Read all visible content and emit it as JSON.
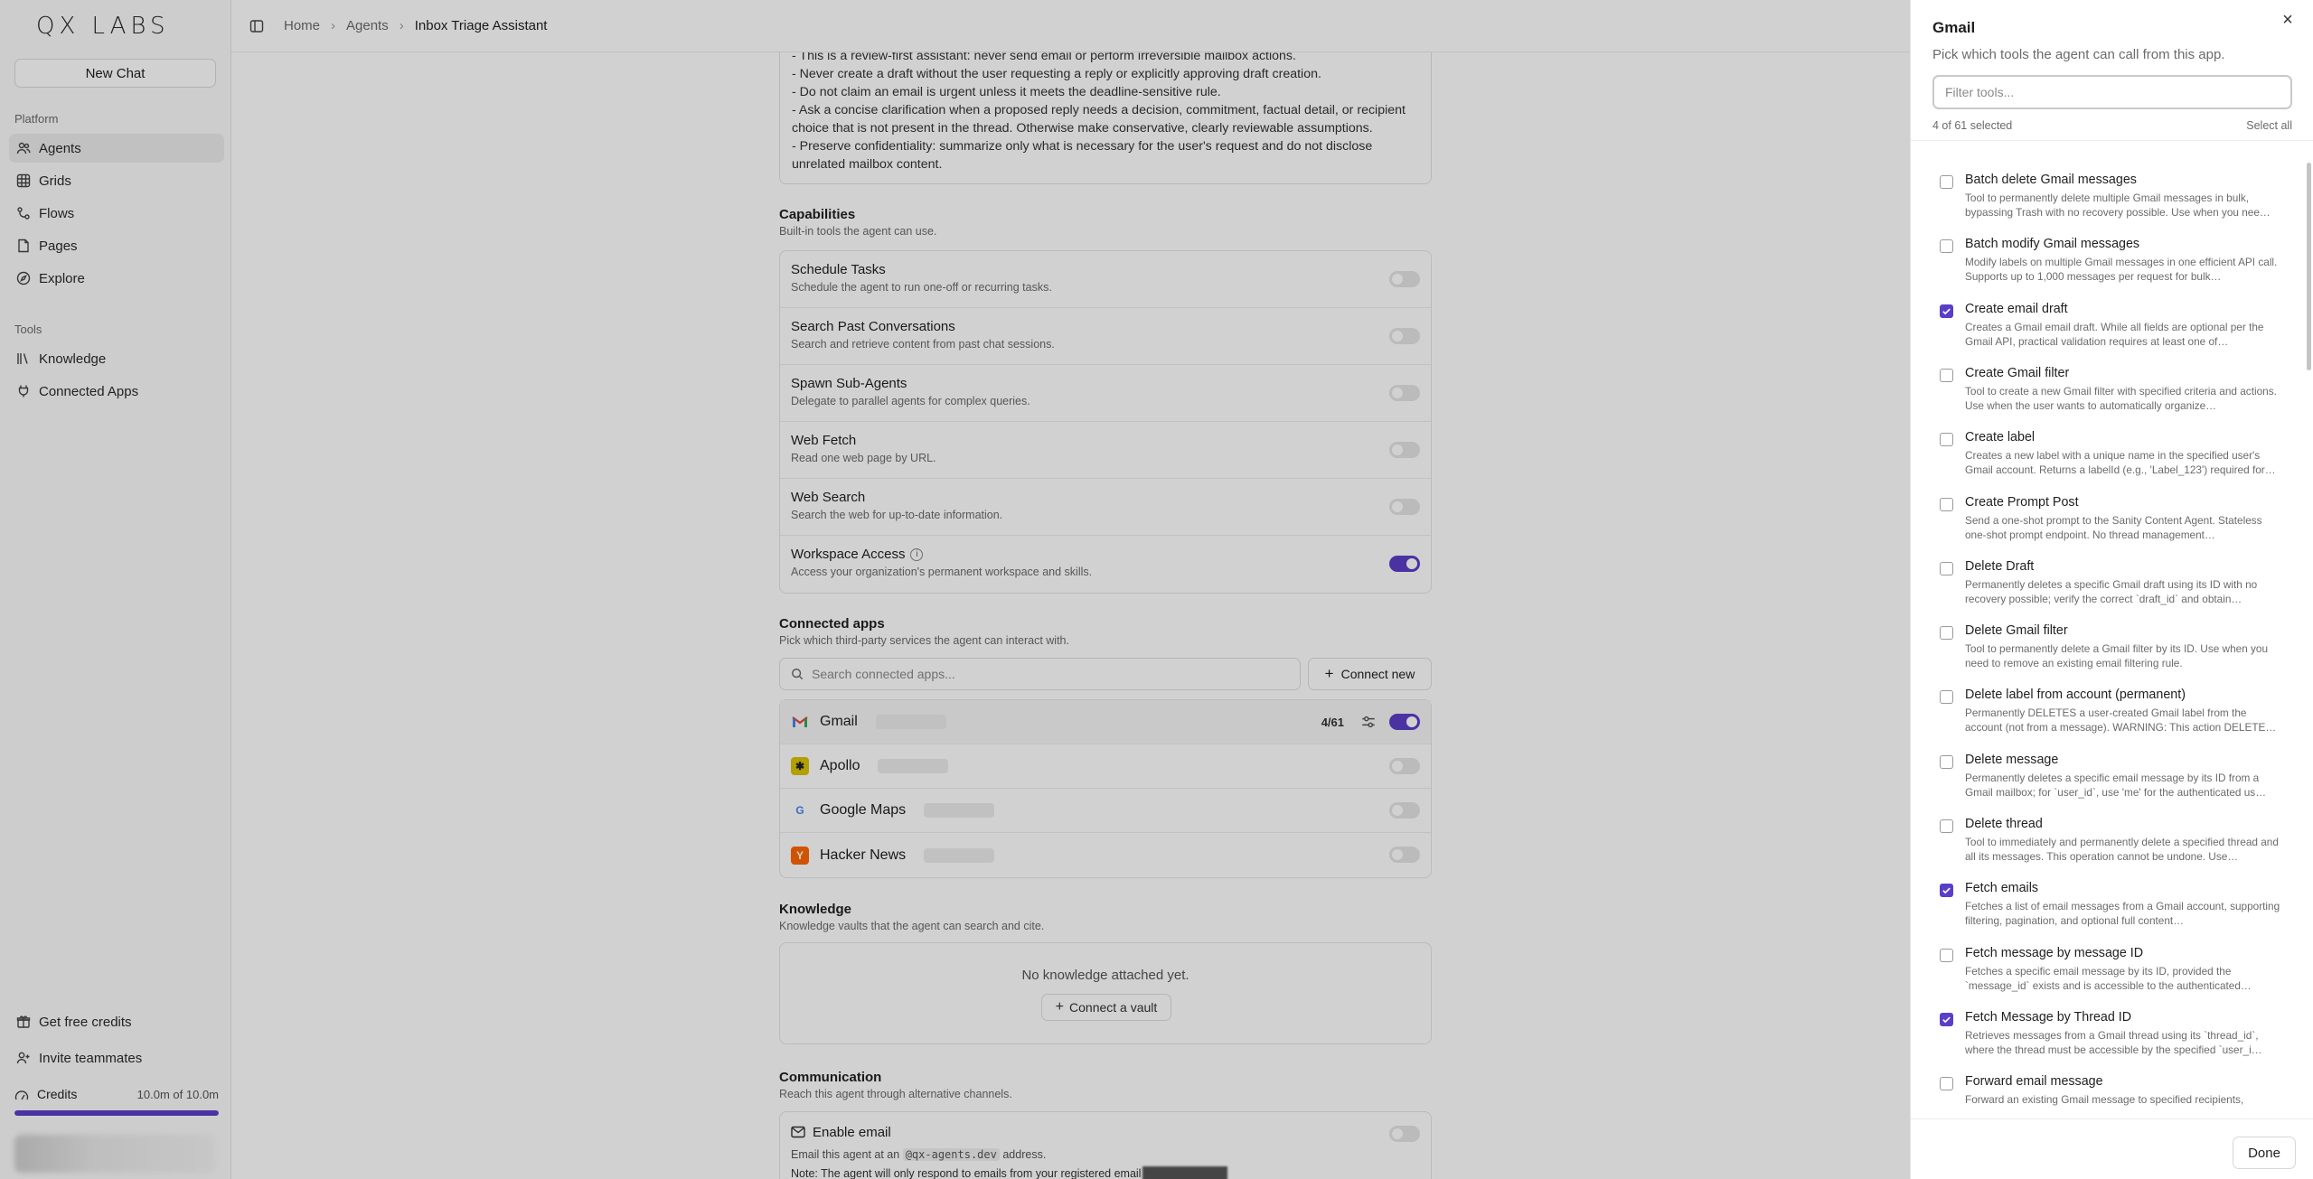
{
  "sidebar": {
    "logo": "QX LABS",
    "new_chat": "New Chat",
    "platform_label": "Platform",
    "platform_items": [
      {
        "label": "Agents",
        "icon": "users-icon"
      },
      {
        "label": "Grids",
        "icon": "grid-icon"
      },
      {
        "label": "Flows",
        "icon": "flow-icon"
      },
      {
        "label": "Pages",
        "icon": "pages-icon"
      },
      {
        "label": "Explore",
        "icon": "compass-icon"
      }
    ],
    "tools_label": "Tools",
    "tools_items": [
      {
        "label": "Knowledge",
        "icon": "library-icon"
      },
      {
        "label": "Connected Apps",
        "icon": "plug-icon"
      }
    ],
    "bottom_items": [
      {
        "label": "Get free credits",
        "icon": "gift-icon"
      },
      {
        "label": "Invite teammates",
        "icon": "user-plus-icon"
      }
    ],
    "credits": {
      "label": "Credits",
      "amount": "10.0m of 10.0m",
      "fill_fraction": 1.0
    }
  },
  "breadcrumb": {
    "home": "Home",
    "agents": "Agents",
    "current": "Inbox Triage Assistant"
  },
  "instructions": [
    "- This is a review-first assistant: never send email or perform irreversible mailbox actions.",
    "- Never create a draft without the user requesting a reply or explicitly approving draft creation.",
    "- Do not claim an email is urgent unless it meets the deadline-sensitive rule.",
    "- Ask a concise clarification when a proposed reply needs a decision, commitment, factual detail, or recipient",
    "choice that is not present in the thread. Otherwise make conservative, clearly reviewable assumptions.",
    "- Preserve confidentiality: summarize only what is necessary for the user's request and do not disclose",
    "unrelated mailbox content."
  ],
  "capabilities": {
    "title": "Capabilities",
    "subtitle": "Built-in tools the agent can use.",
    "items": [
      {
        "name": "Schedule Tasks",
        "desc": "Schedule the agent to run one-off or recurring tasks.",
        "enabled": false
      },
      {
        "name": "Search Past Conversations",
        "desc": "Search and retrieve content from past chat sessions.",
        "enabled": false
      },
      {
        "name": "Spawn Sub-Agents",
        "desc": "Delegate to parallel agents for complex queries.",
        "enabled": false
      },
      {
        "name": "Web Fetch",
        "desc": "Read one web page by URL.",
        "enabled": false
      },
      {
        "name": "Web Search",
        "desc": "Search the web for up-to-date information.",
        "enabled": false
      },
      {
        "name": "Workspace Access",
        "desc": "Access your organization's permanent workspace and skills.",
        "enabled": true
      }
    ]
  },
  "connected_apps": {
    "title": "Connected apps",
    "subtitle": "Pick which third-party services the agent can interact with.",
    "search_placeholder": "Search connected apps...",
    "connect_new": "Connect new",
    "apps": [
      {
        "name": "Gmail",
        "count": "4/61",
        "enabled": true,
        "color": "#d93025",
        "glyph": "M"
      },
      {
        "name": "Apollo",
        "count": "",
        "enabled": false,
        "color": "#d8c400",
        "glyph": "✱"
      },
      {
        "name": "Google Maps",
        "count": "",
        "enabled": false,
        "color": "#4285f4",
        "glyph": "G"
      },
      {
        "name": "Hacker News",
        "count": "",
        "enabled": false,
        "color": "#ff6600",
        "glyph": "Y"
      }
    ]
  },
  "knowledge": {
    "title": "Knowledge",
    "subtitle": "Knowledge vaults that the agent can search and cite.",
    "empty": "No knowledge attached yet.",
    "connect_vault": "Connect a vault"
  },
  "communication": {
    "title": "Communication",
    "subtitle": "Reach this agent through alternative channels.",
    "enable_email": "Enable email",
    "desc_prefix": "Email this agent at an",
    "desc_domain": "@qx-agents.dev",
    "desc_suffix": "address.",
    "note": "Note: The agent will only respond to emails from your registered email"
  },
  "drawer": {
    "title": "Gmail",
    "subtitle": "Pick which tools the agent can call from this app.",
    "filter_placeholder": "Filter tools...",
    "count": "4 of 61 selected",
    "select_all": "Select all",
    "done": "Done",
    "tools": [
      {
        "name": "Batch delete Gmail messages",
        "desc": "Tool to permanently delete multiple Gmail messages in bulk, bypassing Trash with no recovery possible. Use when you nee…",
        "checked": false
      },
      {
        "name": "Batch modify Gmail messages",
        "desc": "Modify labels on multiple Gmail messages in one efficient API call. Supports up to 1,000 messages per request for bulk…",
        "checked": false
      },
      {
        "name": "Create email draft",
        "desc": "Creates a Gmail email draft. While all fields are optional per the Gmail API, practical validation requires at least one of…",
        "checked": true
      },
      {
        "name": "Create Gmail filter",
        "desc": "Tool to create a new Gmail filter with specified criteria and actions. Use when the user wants to automatically organize…",
        "checked": false
      },
      {
        "name": "Create label",
        "desc": "Creates a new label with a unique name in the specified user's Gmail account. Returns a labelId (e.g., 'Label_123') required for…",
        "checked": false
      },
      {
        "name": "Create Prompt Post",
        "desc": "Send a one-shot prompt to the Sanity Content Agent. Stateless one-shot prompt endpoint. No thread management…",
        "checked": false
      },
      {
        "name": "Delete Draft",
        "desc": "Permanently deletes a specific Gmail draft using its ID with no recovery possible; verify the correct `draft_id` and obtain…",
        "checked": false
      },
      {
        "name": "Delete Gmail filter",
        "desc": "Tool to permanently delete a Gmail filter by its ID. Use when you need to remove an existing email filtering rule.",
        "checked": false
      },
      {
        "name": "Delete label from account (permanent)",
        "desc": "Permanently DELETES a user-created Gmail label from the account (not from a message). WARNING: This action DELETE…",
        "checked": false
      },
      {
        "name": "Delete message",
        "desc": "Permanently deletes a specific email message by its ID from a Gmail mailbox; for `user_id`, use 'me' for the authenticated us…",
        "checked": false
      },
      {
        "name": "Delete thread",
        "desc": "Tool to immediately and permanently delete a specified thread and all its messages. This operation cannot be undone. Use…",
        "checked": false
      },
      {
        "name": "Fetch emails",
        "desc": "Fetches a list of email messages from a Gmail account, supporting filtering, pagination, and optional full content…",
        "checked": true
      },
      {
        "name": "Fetch message by message ID",
        "desc": "Fetches a specific email message by its ID, provided the `message_id` exists and is accessible to the authenticated…",
        "checked": false
      },
      {
        "name": "Fetch Message by Thread ID",
        "desc": "Retrieves messages from a Gmail thread using its `thread_id`, where the thread must be accessible by the specified `user_i…",
        "checked": true
      },
      {
        "name": "Forward email message",
        "desc": "Forward an existing Gmail message to specified recipients,",
        "checked": false
      }
    ]
  },
  "colors": {
    "accent": "#5b3ec7",
    "overlay": "rgba(0,0,0,0.18)"
  }
}
